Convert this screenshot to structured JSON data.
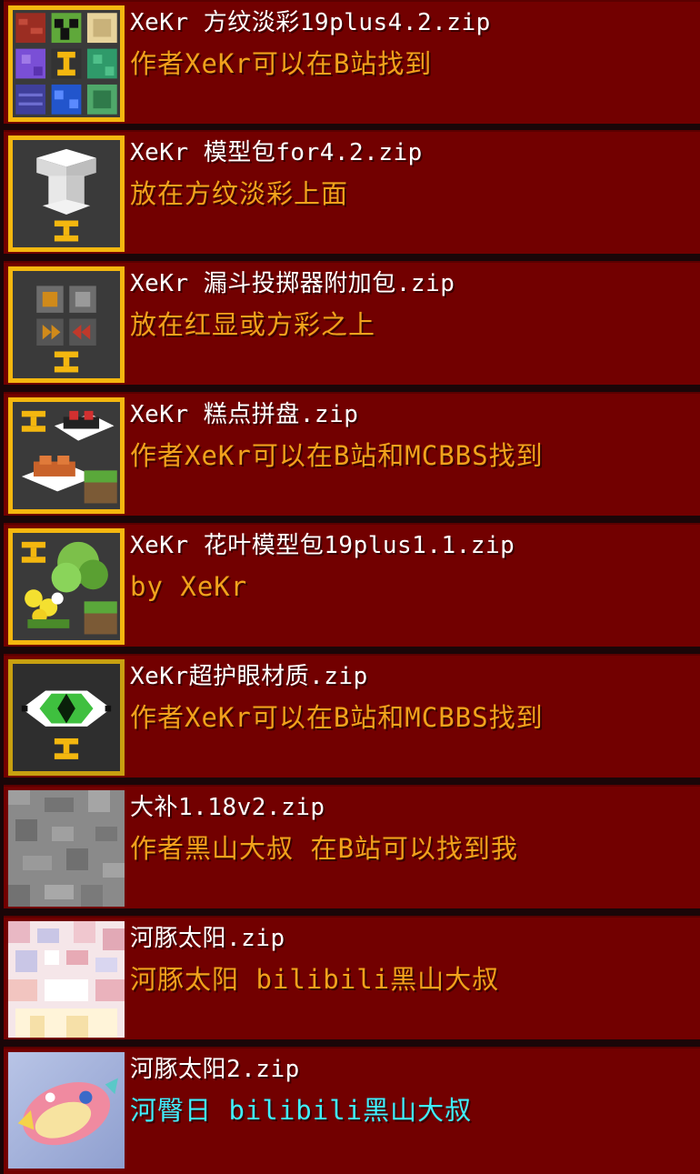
{
  "colors": {
    "row_background": "#720000",
    "title_text": "#ffffff",
    "desc_gold": "#f0a21c",
    "desc_aqua": "#3ff0ff",
    "frame_gold": "#f4b70f"
  },
  "packs": [
    {
      "title": "XeKr 方纹淡彩19plus4.2.zip",
      "description": "作者XeKr可以在B站找到",
      "description_color": "#f0a21c",
      "icon": "block-grid-icon"
    },
    {
      "title": "XeKr 模型包for4.2.zip",
      "description": "放在方纹淡彩上面",
      "description_color": "#f0a21c",
      "icon": "pillar-model-icon"
    },
    {
      "title": "XeKr 漏斗投掷器附加包.zip",
      "description": "放在红显或方彩之上",
      "description_color": "#f0a21c",
      "icon": "hopper-dispenser-icon"
    },
    {
      "title": "XeKr 糕点拼盘.zip",
      "description": "作者XeKr可以在B站和MCBBS找到",
      "description_color": "#f0a21c",
      "icon": "cake-plate-icon"
    },
    {
      "title": "XeKr 花叶模型包19plus1.1.zip",
      "description": "by XeKr",
      "description_color": "#f0a21c",
      "icon": "flower-leaf-icon"
    },
    {
      "title": "XeKr超护眼材质.zip",
      "description": "作者XeKr可以在B站和MCBBS找到",
      "description_color": "#f0a21c",
      "icon": "green-eye-icon"
    },
    {
      "title": "大补1.18v2.zip",
      "description": "作者黑山大叔 在B站可以找到我",
      "description_color": "#f0a21c",
      "icon": "stone-texture-icon"
    },
    {
      "title": "河豚太阳.zip",
      "description": "河豚太阳 bilibili黑山大叔",
      "description_color": "#f0a21c",
      "icon": "pufferfish-pixel-icon"
    },
    {
      "title": "河豚太阳2.zip",
      "description": "河臀日 bilibili黑山大叔",
      "description_color": "#3ff0ff",
      "icon": "pufferfish-art-icon"
    }
  ]
}
